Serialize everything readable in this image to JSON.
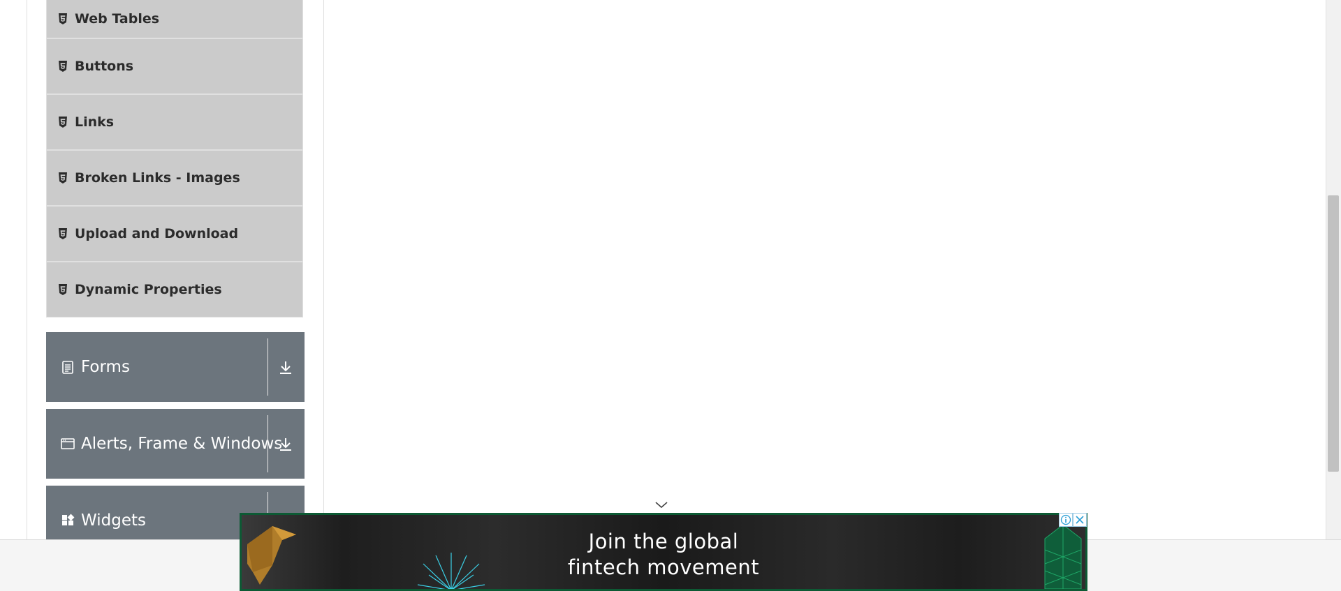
{
  "sidebar": {
    "items": [
      {
        "label": "Web Tables",
        "icon": "html5-icon"
      },
      {
        "label": "Buttons",
        "icon": "html5-icon"
      },
      {
        "label": "Links",
        "icon": "html5-icon"
      },
      {
        "label": "Broken Links - Images",
        "icon": "html5-icon"
      },
      {
        "label": "Upload and Download",
        "icon": "html5-icon"
      },
      {
        "label": "Dynamic Properties",
        "icon": "html5-icon"
      }
    ],
    "groups": [
      {
        "label": "Forms",
        "icon": "document-icon"
      },
      {
        "label": "Alerts, Frame & Windows",
        "icon": "window-icon"
      },
      {
        "label": "Widgets",
        "icon": "widgets-icon"
      }
    ]
  },
  "ad": {
    "headline_line1": "Join the global",
    "headline_line2": "fintech movement",
    "accent_color": "#0d5a34"
  },
  "colors": {
    "menu_item_bg": "#cbcbcb",
    "group_bg": "#6c757d"
  }
}
